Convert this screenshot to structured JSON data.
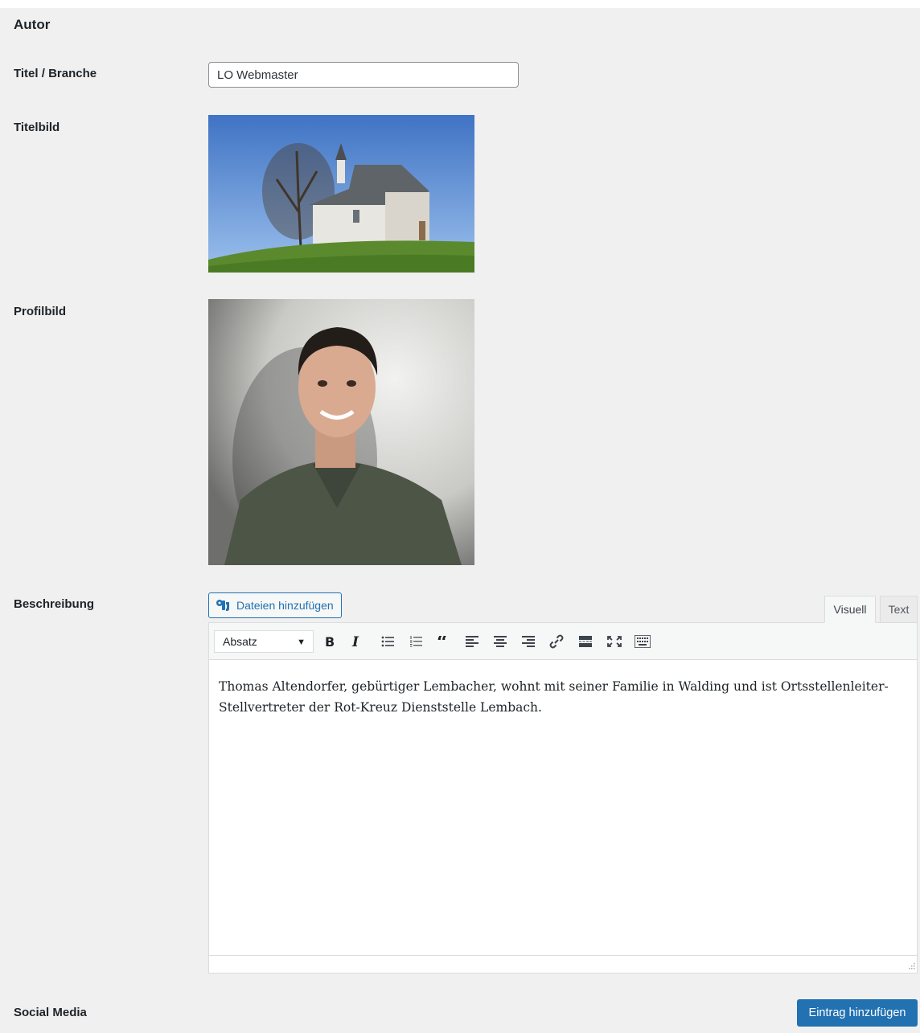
{
  "section": {
    "title": "Autor"
  },
  "fields": {
    "title_label": "Titel / Branche",
    "title_value": "LO Webmaster",
    "cover_label": "Titelbild",
    "profile_label": "Profilbild",
    "description_label": "Beschreibung",
    "social_label": "Social Media"
  },
  "editor": {
    "add_media_label": "Dateien hinzufügen",
    "tabs": {
      "visual": "Visuell",
      "text": "Text",
      "active": "visual"
    },
    "format_select": "Absatz",
    "toolbar_icons": [
      "bold-icon",
      "italic-icon",
      "bullet-list-icon",
      "numbered-list-icon",
      "blockquote-icon",
      "align-left-icon",
      "align-center-icon",
      "align-right-icon",
      "link-icon",
      "read-more-icon",
      "fullscreen-icon",
      "toolbar-toggle-icon"
    ],
    "content": "Thomas Altendorfer, gebürtiger Lembacher, wohnt mit seiner Familie in Walding und ist Ortsstellenleiter-Stellvertreter der Rot-Kreuz Dienststelle Lembach."
  },
  "actions": {
    "add_entry": "Eintrag hinzufügen"
  },
  "colors": {
    "primary": "#2271b1",
    "panel_bg": "#f0f0f1",
    "text": "#1d2327"
  }
}
